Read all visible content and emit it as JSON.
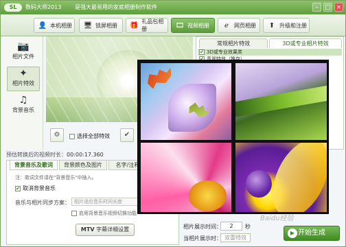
{
  "titlebar": {
    "logo": "SL",
    "app_name": "数码大师2013",
    "slogan": "是强大最易用的家庭相册制作软件",
    "min": "–",
    "max": "□",
    "close": "×"
  },
  "toolbar": {
    "items": [
      {
        "label": "本机相册",
        "icon": "user-icon",
        "glyph": "👤"
      },
      {
        "label": "锁屏相册",
        "icon": "monitor-icon",
        "glyph": "🖥"
      },
      {
        "label": "礼品包相册",
        "icon": "gift-icon",
        "glyph": "🎁"
      },
      {
        "label": "视频相册",
        "icon": "film-icon",
        "glyph": "🎞",
        "active": true
      },
      {
        "label": "网页相册",
        "icon": "globe-icon",
        "glyph": "ℯ"
      },
      {
        "label": "升级和注册",
        "icon": "upgrade-icon",
        "glyph": "⬆"
      }
    ]
  },
  "sidebar": {
    "items": [
      {
        "label": "相片文件",
        "icon": "camera-icon",
        "glyph": "📷"
      },
      {
        "label": "相片特效",
        "icon": "effects-icon",
        "glyph": "✦",
        "active": true
      },
      {
        "label": "背景音乐",
        "icon": "music-icon",
        "glyph": "♫"
      }
    ]
  },
  "preview_controls": {
    "select_all_label": "选择全部特效"
  },
  "right_panel": {
    "tabs": [
      {
        "label": "常规相片特效"
      },
      {
        "label": "3D或专业相片特效",
        "active": true
      }
    ],
    "list": [
      {
        "label": "3D或专业效果类",
        "selected": true
      },
      {
        "label": "青翠特效（推存）"
      }
    ]
  },
  "duration": {
    "label": "预估转换后的视频时长：",
    "value": "00:00:17.360"
  },
  "bottom_panel": {
    "tabs": [
      {
        "label": "背景音乐及歌词",
        "active": true
      },
      {
        "label": "背景颜色及图片"
      },
      {
        "label": "名字/注释"
      }
    ],
    "note": "注：歌词文件请在\"背景音乐\"中插入。",
    "cancel_music_label": "取消背景音乐",
    "sync_label": "音乐与相片同步方案：",
    "sync_placeholder": "相片适应音乐时间长度",
    "enable_mv_label": "启用背景音乐视频切换功能",
    "mtv_label": "MTV",
    "mtv_text": "字幕详细设置"
  },
  "settings": {
    "show_time_label": "相片展示时间：",
    "show_time_value": "2",
    "show_time_unit": "秒",
    "show_mode_label": "当相片展示时：",
    "show_mode_value": "双重特效"
  },
  "start_button": "开始生成",
  "watermark": "Baidu经验"
}
